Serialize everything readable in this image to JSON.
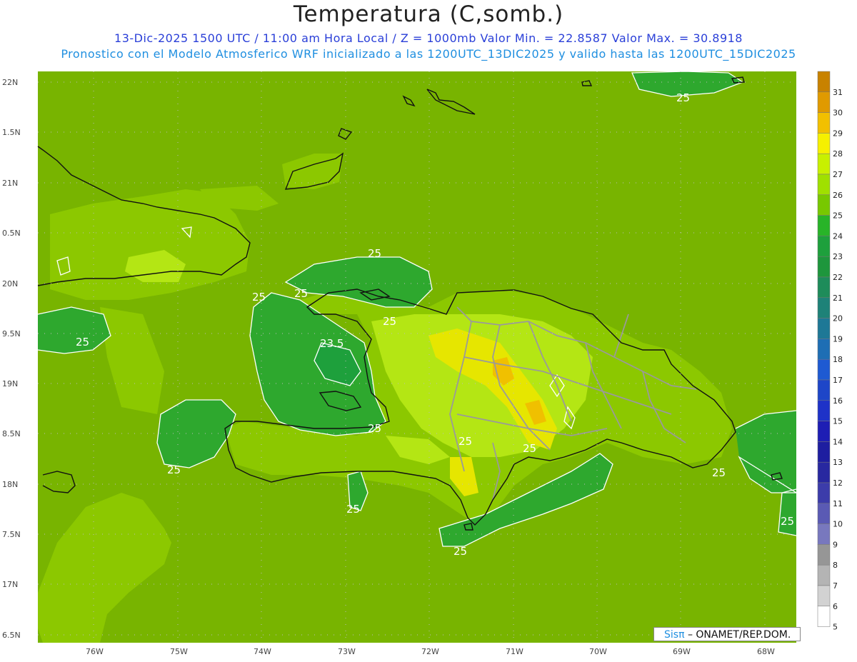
{
  "header": {
    "title": "Temperatura (C,somb.)",
    "subtitle": "13-Dic-2025 1500 UTC / 11:00 am Hora Local / Z = 1000mb  Valor Min. = 22.8587  Valor Max. = 30.8918",
    "description": "Pronostico con el Modelo Atmosferico WRF inicializado a las 1200UTC_13DIC2025 y valido hasta las  1200UTC_15DIC2025"
  },
  "credit": {
    "brand": "Sisπ",
    "text": "– ONAMET/REP.DOM."
  },
  "axes": {
    "lat_labels": [
      "22N",
      "1.5N",
      "21N",
      "0.5N",
      "20N",
      "9.5N",
      "19N",
      "8.5N",
      "18N",
      "7.5N",
      "17N",
      "6.5N"
    ],
    "lon_labels": [
      "76W",
      "75W",
      "74W",
      "73W",
      "72W",
      "71W",
      "70W",
      "69W",
      "68W"
    ]
  },
  "colorbar": {
    "labels": [
      "31",
      "30",
      "29",
      "28",
      "27",
      "26",
      "25",
      "24",
      "23",
      "22",
      "21",
      "20",
      "19",
      "18",
      "17",
      "16",
      "15",
      "14",
      "13",
      "12",
      "11",
      "10",
      "9",
      "8",
      "7",
      "6",
      "5"
    ],
    "colors": [
      "#c88200",
      "#e09a00",
      "#f2c000",
      "#f6f000",
      "#c8f000",
      "#a0e000",
      "#78c800",
      "#28b428",
      "#1ea03c",
      "#1e963c",
      "#1e8c5a",
      "#1e8278",
      "#1e7896",
      "#1e6eb4",
      "#1e5ad2",
      "#1e46c8",
      "#1e32c8",
      "#1e1eb4",
      "#1e1ea0",
      "#2828a0",
      "#3c3caa",
      "#5a5ab4",
      "#7878be",
      "#969696",
      "#b4b4b4",
      "#d2d2d2",
      "#ffffff"
    ]
  },
  "contour_labels": [
    {
      "text": "25",
      "id": "c1"
    },
    {
      "text": "25",
      "id": "c2"
    },
    {
      "text": "25",
      "id": "c3"
    },
    {
      "text": "25",
      "id": "c4"
    },
    {
      "text": "23.5",
      "id": "c5"
    },
    {
      "text": "25",
      "id": "c6"
    },
    {
      "text": "25",
      "id": "c7"
    },
    {
      "text": "25",
      "id": "c8"
    },
    {
      "text": "25",
      "id": "c9"
    },
    {
      "text": "25",
      "id": "c10"
    },
    {
      "text": "25",
      "id": "c11"
    },
    {
      "text": "25",
      "id": "c12"
    },
    {
      "text": "25",
      "id": "c13"
    },
    {
      "text": "25",
      "id": "c14"
    },
    {
      "text": "25",
      "id": "c15"
    }
  ],
  "colors": {
    "base_field": "#78b400",
    "field_26": "#8cc800",
    "field_24": "#2ea82e",
    "field_27": "#b4e614",
    "field_28": "#e6e600",
    "field_29": "#f0c000",
    "coast": "#111111",
    "borders": "#9a9a9a",
    "contour": "#ffffff"
  }
}
